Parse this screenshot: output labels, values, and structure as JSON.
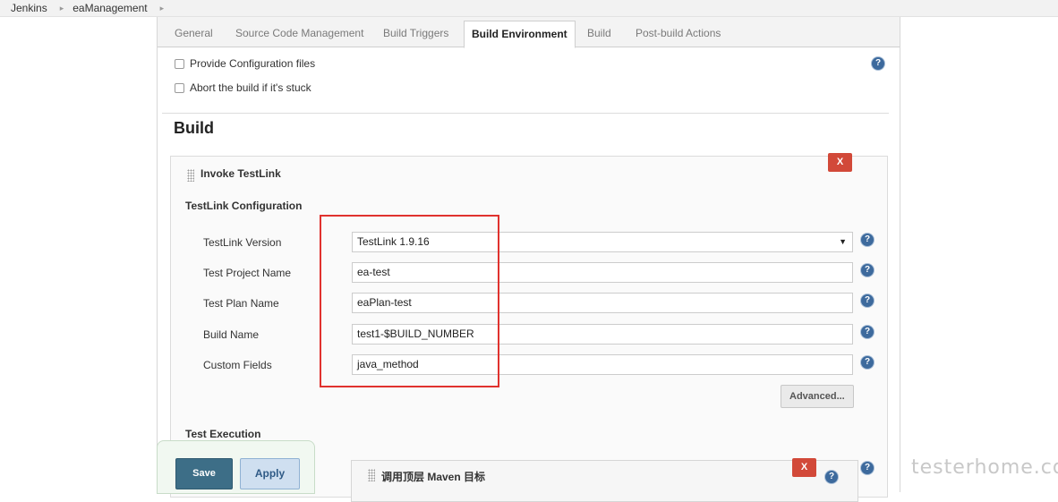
{
  "breadcrumb": {
    "items": [
      "Jenkins",
      "eaManagement"
    ]
  },
  "tabs": [
    "General",
    "Source Code Management",
    "Build Triggers",
    "Build Environment",
    "Build",
    "Post-build Actions"
  ],
  "active_tab": "Build Environment",
  "build_environment": {
    "options": [
      "Provide Configuration files",
      "Abort the build if it's stuck"
    ]
  },
  "build": {
    "section_title": "Build",
    "step": {
      "title": "Invoke TestLink",
      "delete_label": "X",
      "config_title": "TestLink Configuration",
      "fields": {
        "version": {
          "label": "TestLink Version",
          "value": "TestLink 1.9.16"
        },
        "project": {
          "label": "Test Project Name",
          "value": "ea-test"
        },
        "plan": {
          "label": "Test Plan Name",
          "value": "eaPlan-test"
        },
        "build_name": {
          "label": "Build Name",
          "value": "test1-$BUILD_NUMBER"
        },
        "custom_fields": {
          "label": "Custom Fields",
          "value": "java_method"
        }
      },
      "advanced_label": "Advanced...",
      "execution_title": "Test Execution",
      "maven_step_title": "调用顶层 Maven 目标"
    }
  },
  "actions": {
    "save_label": "Save",
    "apply_label": "Apply"
  },
  "help_glyph": "?",
  "watermark": "testerhome.com",
  "colors": {
    "highlight": "#e0322e",
    "delete": "#d24939",
    "save": "#3d6e87",
    "help": "#3d6a9d"
  }
}
